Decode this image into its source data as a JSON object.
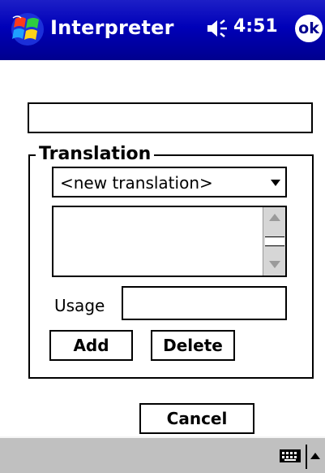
{
  "titlebar": {
    "start_icon": "windows-flag-icon",
    "app_title": "Interpreter",
    "volume_icon": "speaker-icon",
    "time": "4:51",
    "ok_label": "ok",
    "color": "#0000b8"
  },
  "main": {
    "word_input": {
      "value": ""
    },
    "translation": {
      "legend": "Translation",
      "select_value": "<new translation>",
      "list_items": [],
      "usage_label": "Usage",
      "usage_value": "",
      "add_label": "Add",
      "delete_label": "Delete"
    },
    "cancel_label": "Cancel"
  },
  "bottombar": {
    "keyboard_icon": "keyboard-icon",
    "sip_arrow_icon": "chevron-up-icon",
    "color": "#c0c0c0"
  }
}
